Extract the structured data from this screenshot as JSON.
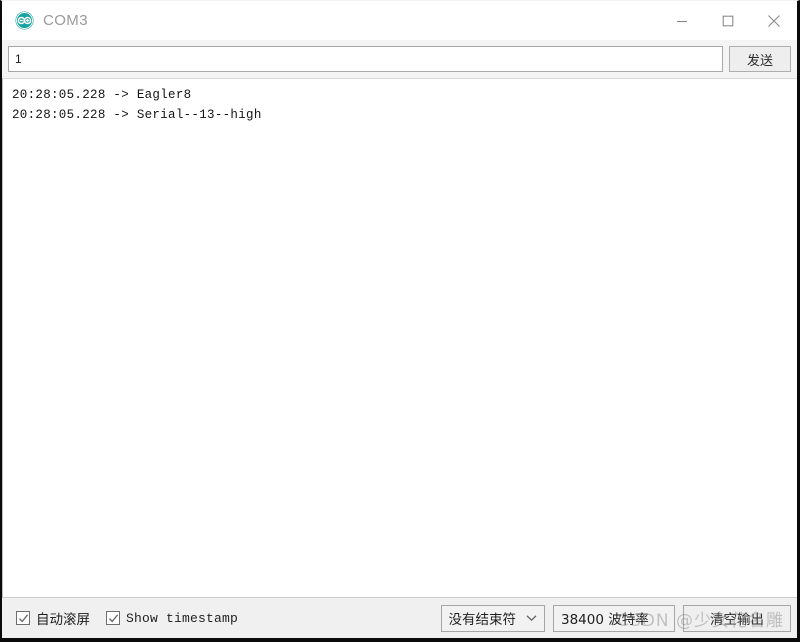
{
  "window": {
    "title": "COM3",
    "logo_icon": "arduino-logo-icon",
    "controls": [
      {
        "name": "minimize-button",
        "icon": "minimize-icon"
      },
      {
        "name": "maximize-button",
        "icon": "maximize-icon"
      },
      {
        "name": "close-button",
        "icon": "close-icon"
      }
    ]
  },
  "send_row": {
    "input_value": "1",
    "input_placeholder": "",
    "send_label": "发送"
  },
  "output": {
    "lines": [
      "20:28:05.228 -> Eagler8",
      "20:28:05.228 -> Serial--13--high"
    ]
  },
  "statusbar": {
    "autoscroll": {
      "label": "自动滚屏",
      "checked": true
    },
    "show_timestamp": {
      "label": "Show timestamp",
      "checked": true
    },
    "line_ending": {
      "value": "没有结束符",
      "chevron_icon": "chevron-down-icon"
    },
    "baud_rate": {
      "value": "38400 波特率"
    },
    "clear_label": "清空输出"
  },
  "watermark": {
    "text": "CSDN @少女花名雕"
  },
  "colors": {
    "accent": "#18a3a3",
    "window_bg": "#ffffff",
    "toolbar_bg": "#f4f4f4",
    "status_bg": "#f0f0f0",
    "text": "#141414",
    "title_text": "#9a9a9a"
  }
}
